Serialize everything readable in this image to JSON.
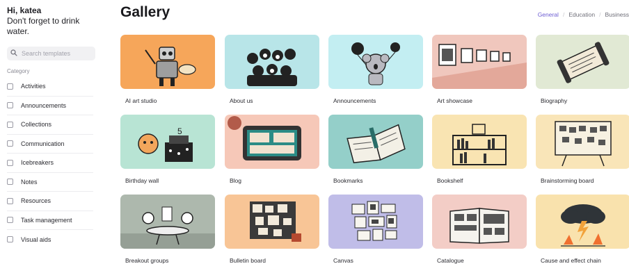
{
  "sidebar": {
    "greeting": "Hi, katea",
    "reminder": "Don't forget to drink water.",
    "search_placeholder": "Search templates",
    "category_label": "Category",
    "categories": [
      "Activities",
      "Announcements",
      "Collections",
      "Communication",
      "Icebreakers",
      "Notes",
      "Resources",
      "Task management",
      "Visual aids"
    ]
  },
  "header": {
    "title": "Gallery",
    "tabs": [
      "General",
      "Education",
      "Business"
    ],
    "active_tab": "General"
  },
  "colors": {
    "accent": "#6d5dd3"
  },
  "gallery": [
    {
      "label": "AI art studio",
      "bg": "#f6a65a",
      "icon": "robot-painter-illustration"
    },
    {
      "label": "About us",
      "bg": "#b8e5e8",
      "icon": "team-group-illustration"
    },
    {
      "label": "Announcements",
      "bg": "#c3eef2",
      "icon": "koala-balloons-illustration"
    },
    {
      "label": "Art showcase",
      "bg": "#f0c7bd",
      "icon": "gallery-wall-illustration"
    },
    {
      "label": "Biography",
      "bg": "#e1e9d4",
      "icon": "scroll-illustration"
    },
    {
      "label": "Birthday wall",
      "bg": "#b8e4d4",
      "icon": "tiger-cake-illustration"
    },
    {
      "label": "Blog",
      "bg": "#f6c8b8",
      "icon": "tablet-blog-illustration"
    },
    {
      "label": "Bookmarks",
      "bg": "#94cfc9",
      "icon": "open-book-illustration"
    },
    {
      "label": "Bookshelf",
      "bg": "#f9e4b2",
      "icon": "bookshelf-illustration"
    },
    {
      "label": "Brainstorming board",
      "bg": "#f9e5b8",
      "icon": "board-illustration"
    },
    {
      "label": "Breakout groups",
      "bg": "#adb8ad",
      "icon": "meeting-table-illustration"
    },
    {
      "label": "Bulletin board",
      "bg": "#f8c596",
      "icon": "corkboard-illustration"
    },
    {
      "label": "Canvas",
      "bg": "#c0bde8",
      "icon": "collage-illustration"
    },
    {
      "label": "Catalogue",
      "bg": "#f3cdc6",
      "icon": "magazine-illustration"
    },
    {
      "label": "Cause and effect chain",
      "bg": "#f9e2ad",
      "icon": "storm-cloud-illustration"
    }
  ]
}
